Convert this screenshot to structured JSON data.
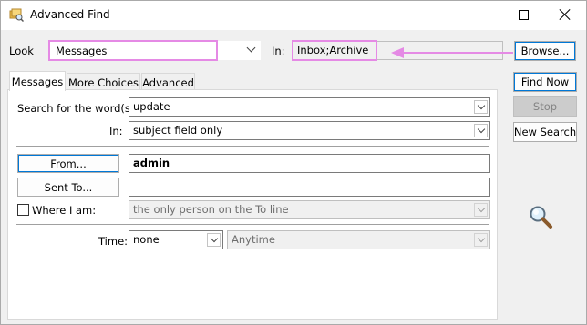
{
  "window": {
    "title": "Advanced Find"
  },
  "top": {
    "look_label": "Look",
    "look_value": "Messages",
    "in_label": "In:",
    "in_value": "Inbox;Archive",
    "browse_label": "Browse..."
  },
  "tabs": [
    {
      "label": "Messages",
      "active": true
    },
    {
      "label": "More Choices",
      "active": false
    },
    {
      "label": "Advanced",
      "active": false
    }
  ],
  "side_buttons": {
    "find_now": "Find Now",
    "stop": "Stop",
    "new_search": "New Search"
  },
  "form": {
    "search_words_label": "Search for the word(s):",
    "search_words_value": "update",
    "in_label": "In:",
    "in_value": "subject field only",
    "from_button": "From...",
    "from_value": "admin",
    "sent_to_button": "Sent To...",
    "sent_to_value": "",
    "where_i_am_label": "Where I am:",
    "where_i_am_value": "the only person on the To line",
    "time_label": "Time:",
    "time_value": "none",
    "time_range_value": "Anytime"
  },
  "colors": {
    "highlight": "#e58ae5",
    "accent": "#0078d7"
  },
  "icons": [
    "advanced-find-app-icon",
    "minimize-icon",
    "maximize-icon",
    "close-icon",
    "magnifier-icon",
    "arrow-icon",
    "chevron-down-icon"
  ]
}
